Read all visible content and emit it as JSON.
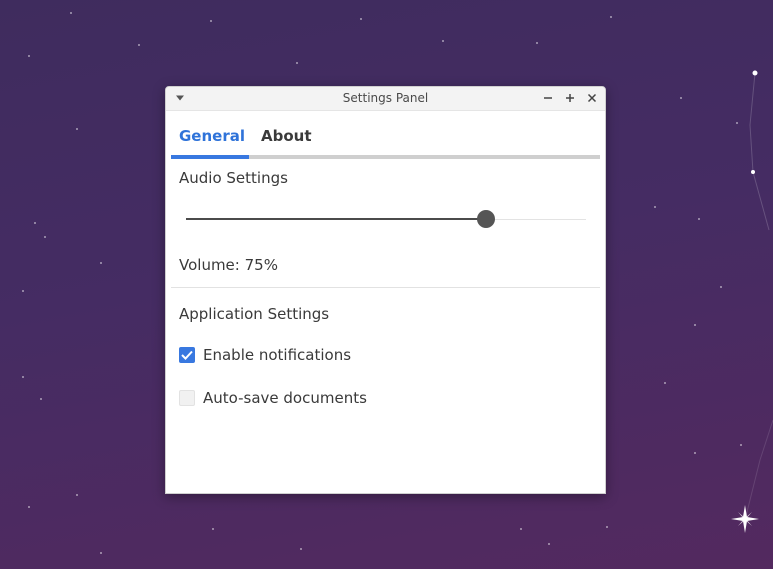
{
  "desktop": {
    "background_top": "#3f2c5e",
    "background_bottom": "#53295f"
  },
  "window": {
    "title": "Settings Panel",
    "menu_icon": "chevron-down-icon",
    "minimize_icon": "minimize-icon",
    "maximize_icon": "maximize-icon",
    "close_icon": "close-icon"
  },
  "tabs": [
    {
      "label": "General",
      "active": true
    },
    {
      "label": "About",
      "active": false
    }
  ],
  "colors": {
    "accent": "#3878e0",
    "tab_active_text": "#2f73d9",
    "text": "#3a3a3a"
  },
  "audio": {
    "heading": "Audio Settings",
    "volume_percent": 75,
    "volume_label": "Volume: 75%"
  },
  "application": {
    "heading": "Application Settings",
    "notifications": {
      "label": "Enable notifications",
      "checked": true
    },
    "autosave": {
      "label": "Auto-save documents",
      "checked": false
    }
  }
}
